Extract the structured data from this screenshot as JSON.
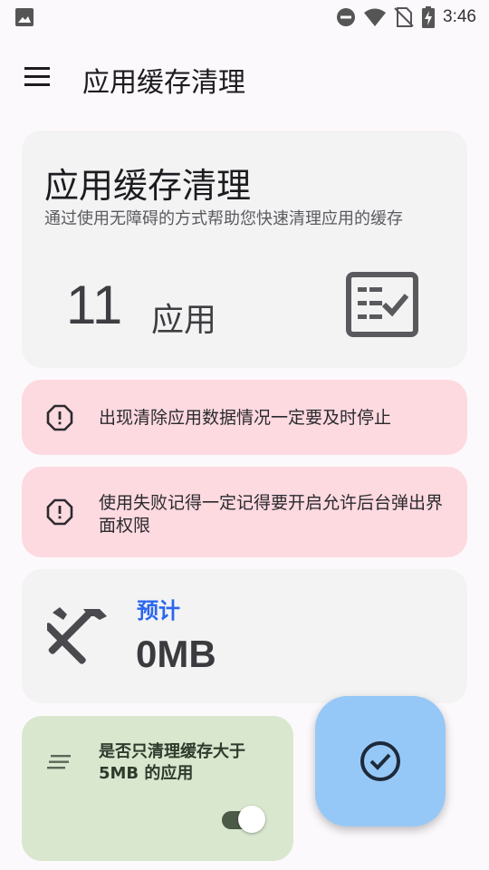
{
  "status_bar": {
    "time": "3:46",
    "icons": [
      "gallery-icon",
      "do-not-disturb-icon",
      "wifi-icon",
      "no-sim-icon",
      "battery-charging-icon"
    ]
  },
  "app_bar": {
    "title": "应用缓存清理",
    "menu_icon": "hamburger-menu-icon"
  },
  "summary": {
    "title": "应用缓存清理",
    "description": "通过使用无障碍的方式帮助您快速清理应用的缓存",
    "app_count": "11",
    "app_unit": "应用",
    "icon": "checklist-icon"
  },
  "warnings": [
    {
      "icon": "alert-octagon-icon",
      "text": "出现清除应用数据情况一定要及时停止"
    },
    {
      "icon": "alert-octagon-icon",
      "text": "使用失败记得一定记得要开启允许后台弹出界面权限"
    }
  ],
  "estimate": {
    "icon": "tools-icon",
    "label": "预计",
    "value": "0MB"
  },
  "option": {
    "icon": "lines-icon",
    "text": "是否只清理缓存大于 5MB 的应用",
    "toggle_on": true
  },
  "fab": {
    "icon": "check-circle-icon"
  },
  "colors": {
    "background": "#fcf9fc",
    "card": "#f3f3f3",
    "warning": "#fdd9e0",
    "option": "#d9e7cf",
    "fab": "#96c8f7",
    "accent_blue": "#2b66f0"
  }
}
